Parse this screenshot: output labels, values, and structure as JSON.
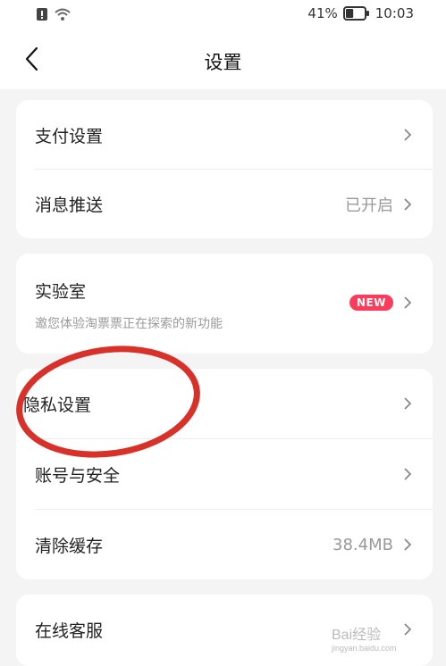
{
  "status_bar": {
    "battery_percent": "41%",
    "battery_level": 0.41,
    "time": "10:03"
  },
  "header": {
    "title": "设置"
  },
  "groups": [
    {
      "items": [
        {
          "label": "支付设置",
          "value": ""
        },
        {
          "label": "消息推送",
          "value": "已开启"
        }
      ]
    },
    {
      "items": [
        {
          "label": "实验室",
          "subtitle": "邀您体验淘票票正在探索的新功能",
          "badge": "NEW"
        }
      ]
    },
    {
      "items": [
        {
          "label": "隐私设置",
          "value": ""
        },
        {
          "label": "账号与安全",
          "value": ""
        },
        {
          "label": "清除缓存",
          "value": "38.4MB"
        }
      ]
    },
    {
      "items": [
        {
          "label": "在线客服",
          "value": ""
        }
      ]
    }
  ],
  "watermark": {
    "text": "Bai经验",
    "url_text": "jingyan.baidu.com"
  },
  "colors": {
    "accent": "#ff3b5c",
    "annotation": "#d8312a",
    "background": "#f4f4f4"
  },
  "icons": [
    "notification-icon",
    "wifi-icon",
    "battery-icon",
    "back-arrow-icon",
    "chevron-right-icon"
  ]
}
